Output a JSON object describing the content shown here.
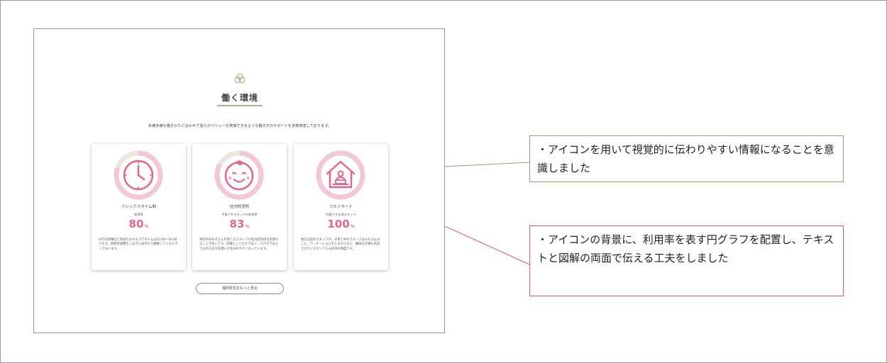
{
  "page": {
    "title": "働く環境",
    "lead": "多様多様な働きかたに合わせて個人がバリューを発揮できるような働き方のサポートを多数用意しております。",
    "more_button": "福利厚生をもっと見る"
  },
  "cards": [
    {
      "name": "フレックスタイム制",
      "sub": "取得率",
      "value": "80",
      "unit": "%",
      "desc": "HTSの目曜など毎日行われるコアタイムは10:00〜16:00ですが、時間の調整をしながら海外から勤務しているスタッフもいます。",
      "icon": "clock-icon",
      "ring_fill": 0.8
    },
    {
      "name": "社内託児所",
      "sub": "子育て中スタッフの利用率",
      "value": "83",
      "unit": "%",
      "desc": "共同作のお子さんを育てるスタッフが社内託児所を利用することが多いです。同僚としてだけでなく、パパママならではの工夫や気遣いが生まれやすくなっています。",
      "icon": "baby-face-icon",
      "ring_fill": 0.83
    },
    {
      "name": "フルリモート",
      "sub": "利用できる地スタッフ",
      "value": "100",
      "unit": "%",
      "desc": "地方在住のスタッフや、子育て中のスタッフはもちろんのこと、ワーケーションをしながらなど、趣味も仕事も充実させたいスタッフにも好評の制度です。",
      "icon": "home-office-icon",
      "ring_fill": 1.0
    }
  ],
  "annotations": [
    {
      "text": "・アイコンを用いて視覚的に伝わりやすい情報になることを意識しました",
      "color": "#9d9a77"
    },
    {
      "text": "・アイコンの背景に、利用率を表す円グラフを配置し、テキストと図解の両面で伝える工夫をしました",
      "color": "#e0567f"
    }
  ],
  "colors": {
    "accent_pink": "#e0668f",
    "ring_track": "#ece6dc",
    "gold_line": "#b8ad8a"
  }
}
